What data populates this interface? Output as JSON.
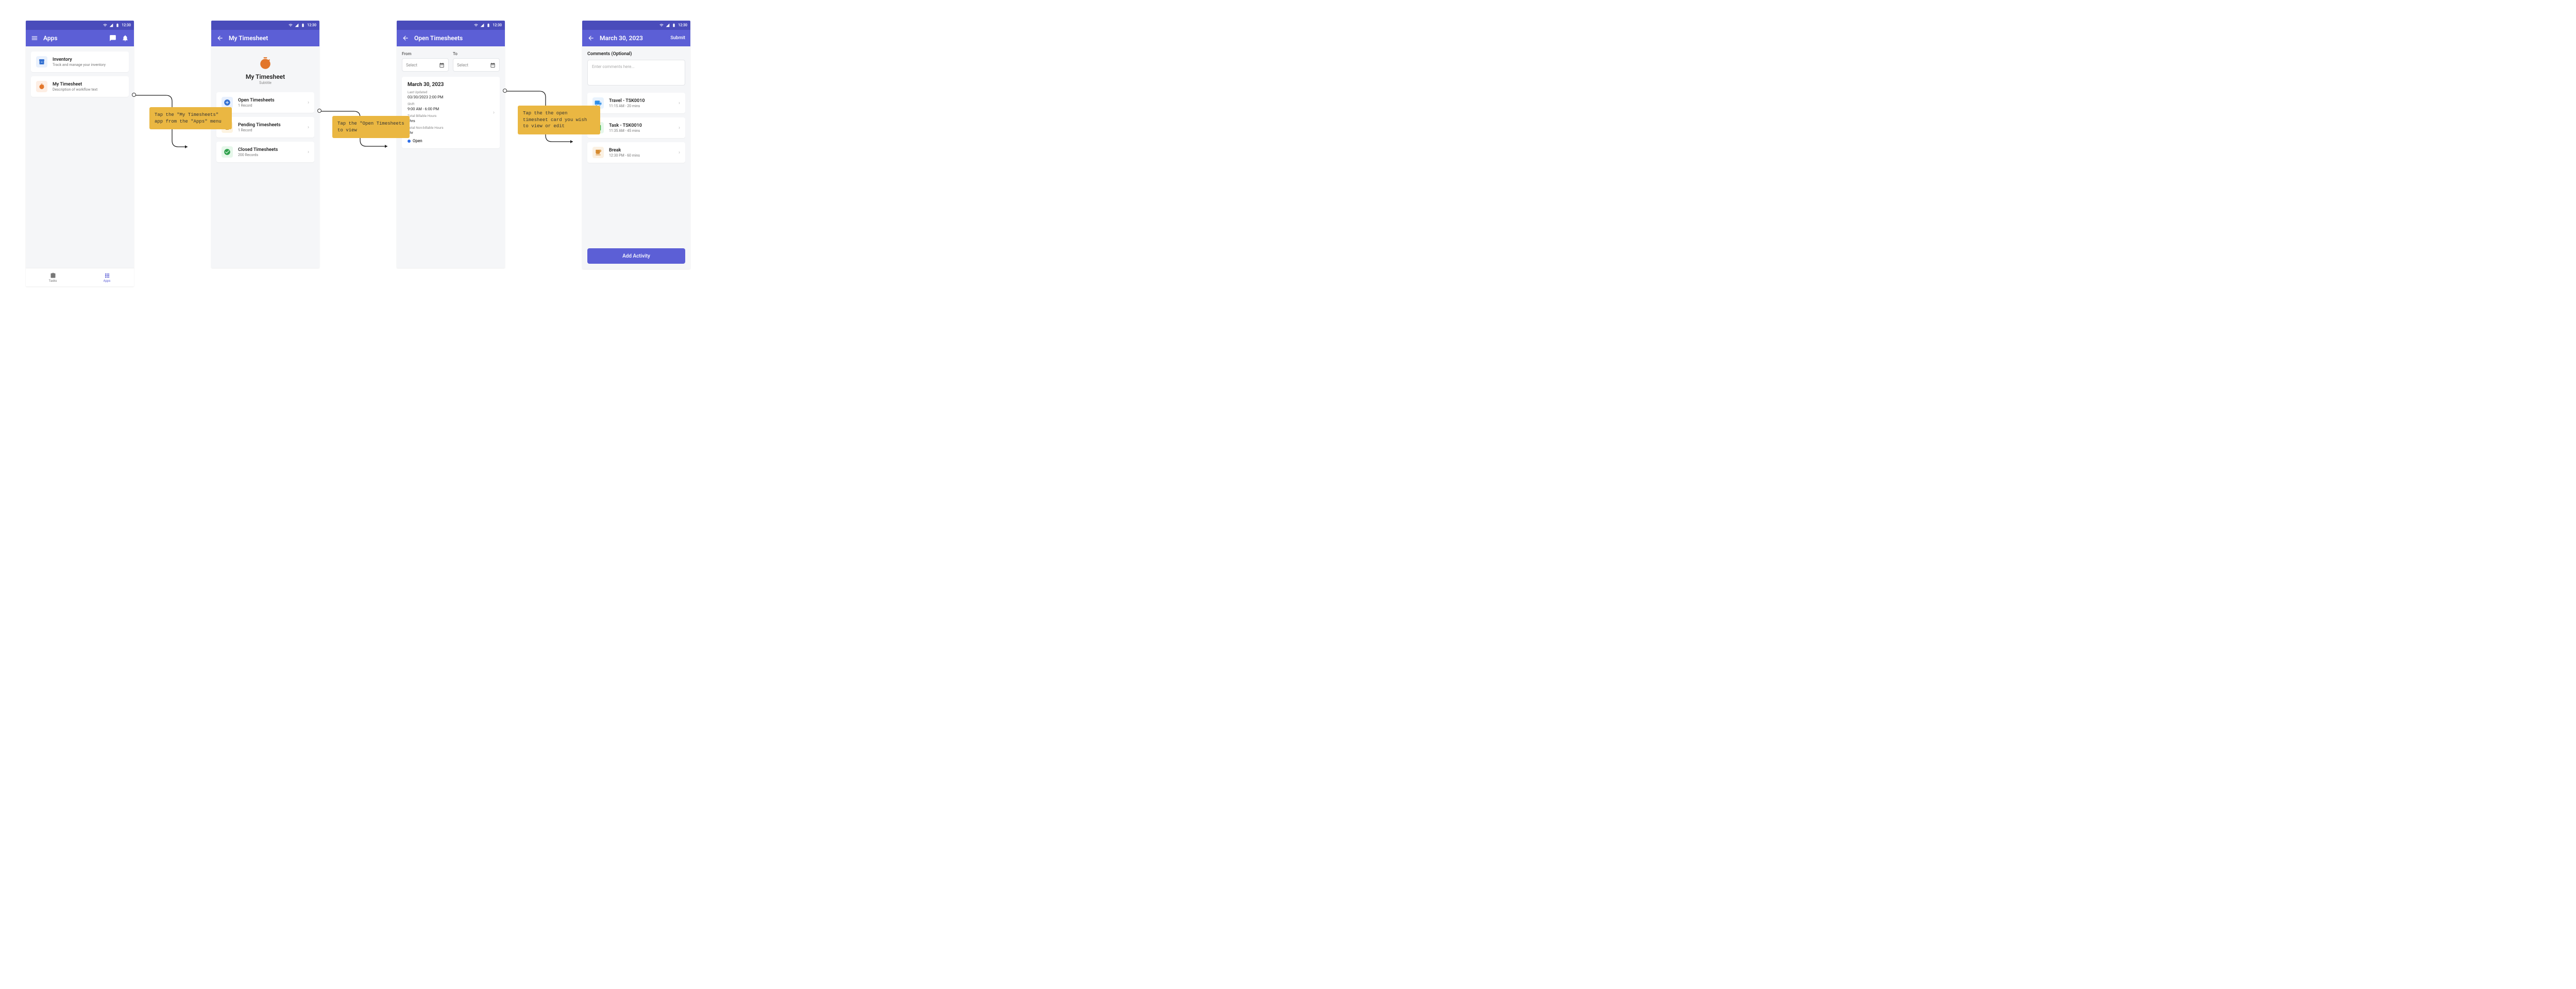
{
  "statusbar": {
    "time": "12:30"
  },
  "screen1": {
    "title": "Apps",
    "apps": [
      {
        "name": "Inventory",
        "desc": "Track and manage your inventory"
      },
      {
        "name": "My Timesheet",
        "desc": "Description of workflow text"
      }
    ],
    "bottomnav": {
      "tasks": "Tasks",
      "apps": "Apps"
    }
  },
  "callout1": "Tap the \"My Timesheets\" app from the \"Apps\" menu",
  "screen2": {
    "title": "My Timesheet",
    "header": {
      "title": "My Timesheet",
      "subtitle": "Subtitle"
    },
    "lists": [
      {
        "title": "Open Timesheets",
        "sub": "1 Record"
      },
      {
        "title": "Pending Timesheets",
        "sub": "1 Record"
      },
      {
        "title": "Closed Timesheets",
        "sub": "200 Records"
      }
    ]
  },
  "callout2": "Tap the \"Open Timesheets to view",
  "screen3": {
    "title": "Open Timesheets",
    "from_label": "From",
    "to_label": "To",
    "select_placeholder": "Select",
    "card": {
      "title": "March 30, 2023",
      "labels": {
        "last_updated": "Last Updated",
        "shift": "Shift",
        "billable": "Total Billable Hours",
        "nonbillable": "Total Non-billable Hours"
      },
      "values": {
        "last_updated": "03/30/2023 2:00 PM",
        "shift": "9:00 AM - 6:00 PM",
        "billable": "8hrs",
        "nonbillable": "1hr"
      },
      "status": "Open",
      "status_color": "#2f6fe8"
    }
  },
  "callout3": "Tap the the open timesheet card you wish to view or edit",
  "screen4": {
    "title": "March 30, 2023",
    "submit": "Submit",
    "comments_label": "Comments (Optional)",
    "comments_placeholder": "Enter comments here...",
    "activities": [
      {
        "title": "Travel - TSK0010",
        "sub": "11:15 AM - 20 mins",
        "icon": "truck",
        "color": "#2f8ee8"
      },
      {
        "title": "Task - TSK0010",
        "sub": "11:35 AM - 45 mins",
        "icon": "task",
        "color": "#2fbf5a"
      },
      {
        "title": "Break",
        "sub": "12:30 PM - 60 mins",
        "icon": "coffee",
        "color": "#d68a2f"
      }
    ],
    "button": "Add Activity"
  }
}
